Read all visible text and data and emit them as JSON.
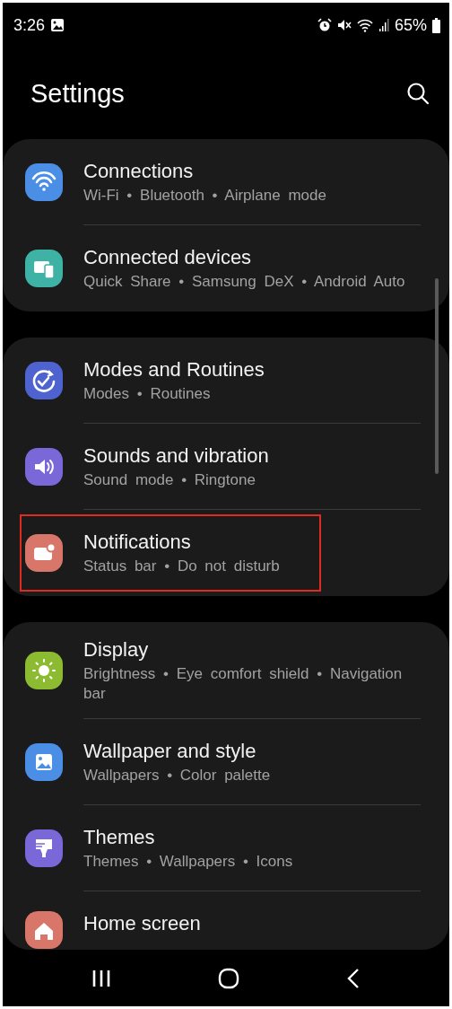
{
  "status_bar": {
    "time": "3:26",
    "battery": "65%"
  },
  "header": {
    "title": "Settings"
  },
  "groups": [
    {
      "items": [
        {
          "color": "#4a8ee6",
          "title": "Connections",
          "subtitle": "Wi-Fi • Bluetooth • Airplane mode",
          "highlighted": false
        },
        {
          "color": "#3eb3a5",
          "title": "Connected devices",
          "subtitle": "Quick Share • Samsung DeX • Android Auto",
          "highlighted": false
        }
      ]
    },
    {
      "items": [
        {
          "color": "#4f63d0",
          "title": "Modes and Routines",
          "subtitle": "Modes • Routines",
          "highlighted": false
        },
        {
          "color": "#7a68d8",
          "title": "Sounds and vibration",
          "subtitle": "Sound mode • Ringtone",
          "highlighted": false
        },
        {
          "color": "#d9766a",
          "title": "Notifications",
          "subtitle": "Status bar • Do not disturb",
          "highlighted": true
        }
      ]
    },
    {
      "items": [
        {
          "color": "#8cbb32",
          "title": "Display",
          "subtitle": "Brightness • Eye comfort shield • Navigation bar",
          "highlighted": false
        },
        {
          "color": "#4a8ee6",
          "title": "Wallpaper and style",
          "subtitle": "Wallpapers • Color palette",
          "highlighted": false
        },
        {
          "color": "#7a68d8",
          "title": "Themes",
          "subtitle": "Themes • Wallpapers • Icons",
          "highlighted": false
        },
        {
          "color": "#d9766a",
          "title": "Home screen",
          "highlighted": false
        }
      ]
    }
  ]
}
